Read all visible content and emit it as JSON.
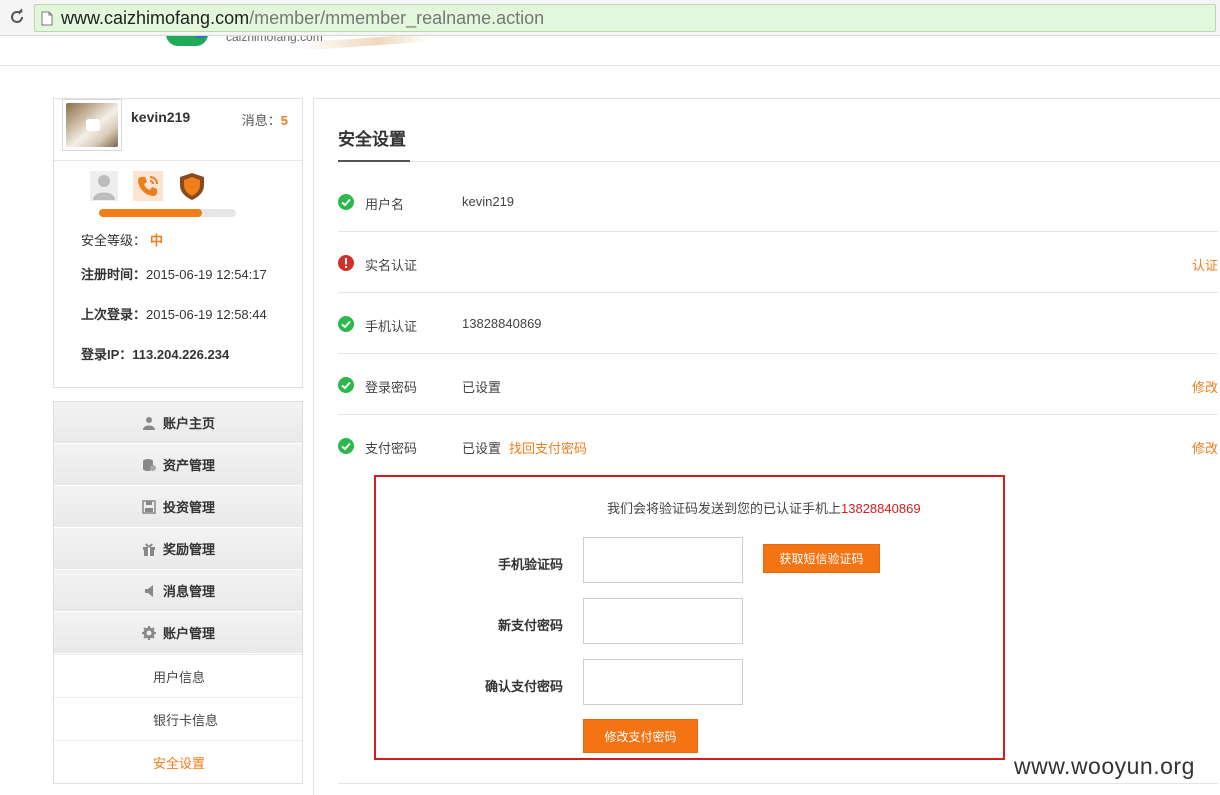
{
  "browser": {
    "url_host": "www.caizhimofang.com",
    "url_path": "/member/mmember_realname.action"
  },
  "header": {
    "logo_text": "caizhimofang.com"
  },
  "profile": {
    "username": "kevin219",
    "messages_label": "消息：",
    "messages_count": "5",
    "security_progress_fraction": 0.75,
    "security_level_label": "安全等级：",
    "security_level_value": "中",
    "register_label": "注册时间：",
    "register_time": "2015-06-19 12:54:17",
    "last_login_label": "上次登录：",
    "last_login_time": "2015-06-19 12:58:44",
    "login_ip_label": "登录IP：",
    "login_ip": "113.204.226.234"
  },
  "menu": {
    "items": [
      {
        "label": "账户主页",
        "icon": "user-icon"
      },
      {
        "label": "资产管理",
        "icon": "coins-icon"
      },
      {
        "label": "投资管理",
        "icon": "save-icon"
      },
      {
        "label": "奖励管理",
        "icon": "gift-icon"
      },
      {
        "label": "消息管理",
        "icon": "speaker-icon"
      },
      {
        "label": "账户管理",
        "icon": "gear-icon"
      }
    ],
    "sub_items": [
      "用户信息",
      "银行卡信息",
      "安全设置"
    ]
  },
  "main": {
    "title": "安全设置",
    "rows": [
      {
        "status": "ok",
        "label": "用户名",
        "value": "kevin219",
        "link": "",
        "action": ""
      },
      {
        "status": "warn",
        "label": "实名认证",
        "value": "",
        "link": "",
        "action": "认证"
      },
      {
        "status": "ok",
        "label": "手机认证",
        "value": "13828840869",
        "link": "",
        "action": ""
      },
      {
        "status": "ok",
        "label": "登录密码",
        "value": "已设置",
        "link": "",
        "action": "修改"
      },
      {
        "status": "ok",
        "label": "支付密码",
        "value": "已设置",
        "link": "找回支付密码",
        "action": "修改"
      }
    ]
  },
  "pay_form": {
    "notice_text": "我们会将验证码发送到您的已认证手机上",
    "notice_phone": "13828840869",
    "sms_code_label": "手机验证码",
    "get_sms_button": "获取短信验证码",
    "new_password_label": "新支付密码",
    "confirm_password_label": "确认支付密码",
    "submit_button": "修改支付密码"
  },
  "watermark": "www.wooyun.org",
  "colors": {
    "accent": "#f07d1a",
    "button": "#f47414",
    "ok_green": "#2db84d",
    "warn_red": "#d0302a",
    "highlight_border": "#d11f1f"
  }
}
